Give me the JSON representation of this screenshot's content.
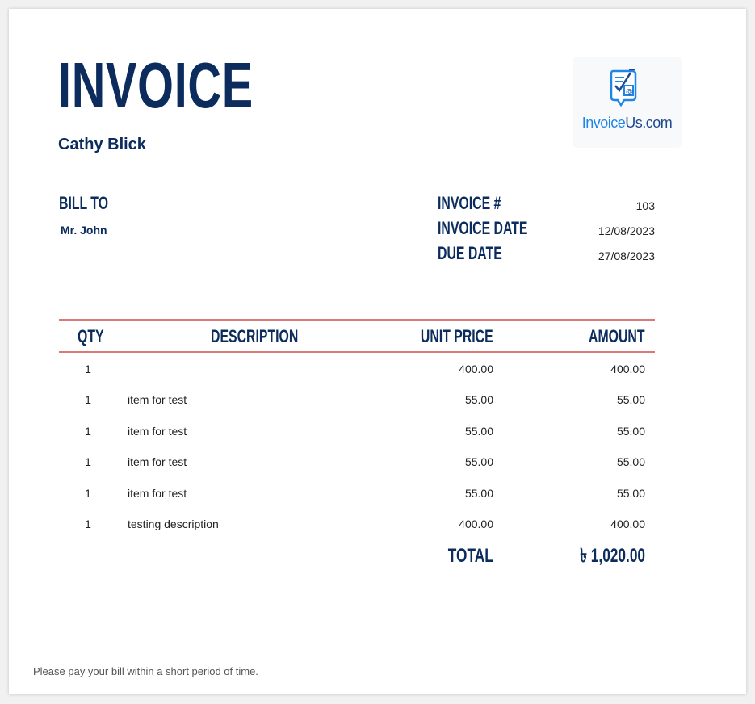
{
  "invoice": {
    "title": "INVOICE",
    "sender_name": "Cathy Blick",
    "logo": {
      "icon": "invoice-document-icon",
      "text_part1": "Invoice",
      "text_part2": "Us.com"
    },
    "bill_to_label": "BILL TO",
    "bill_to_name": "Mr. John",
    "meta": [
      {
        "label": "INVOICE #",
        "value": "103"
      },
      {
        "label": "INVOICE DATE",
        "value": "12/08/2023"
      },
      {
        "label": "DUE DATE",
        "value": "27/08/2023"
      }
    ],
    "table": {
      "headers": {
        "qty": "QTY",
        "description": "DESCRIPTION",
        "unit_price": "UNIT PRICE",
        "amount": "AMOUNT"
      },
      "rows": [
        {
          "qty": "1",
          "description": "",
          "unit_price": "400.00",
          "amount": "400.00"
        },
        {
          "qty": "1",
          "description": "item for test",
          "unit_price": "55.00",
          "amount": "55.00"
        },
        {
          "qty": "1",
          "description": "item for test",
          "unit_price": "55.00",
          "amount": "55.00"
        },
        {
          "qty": "1",
          "description": "item for test",
          "unit_price": "55.00",
          "amount": "55.00"
        },
        {
          "qty": "1",
          "description": "item for test",
          "unit_price": "55.00",
          "amount": "55.00"
        },
        {
          "qty": "1",
          "description": "testing description",
          "unit_price": "400.00",
          "amount": "400.00"
        }
      ]
    },
    "total_label": "TOTAL",
    "total_value": "৳ 1,020.00",
    "footer_note": "Please pay your bill within a short period of time."
  },
  "colors": {
    "navy": "#0b2c5d",
    "rule": "#d9797a",
    "logo_blue": "#1e86e8"
  }
}
